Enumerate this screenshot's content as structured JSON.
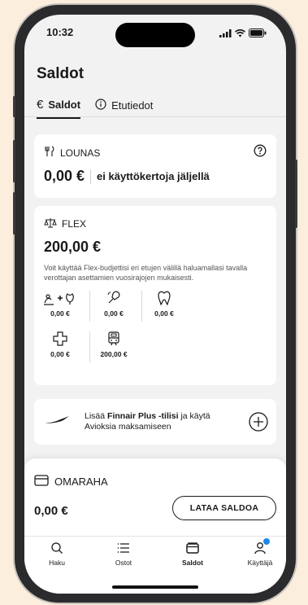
{
  "status_bar": {
    "time": "10:32"
  },
  "header": {
    "title": "Saldot"
  },
  "tabs": [
    {
      "label": "Saldot",
      "icon": "euro-icon",
      "active": true
    },
    {
      "label": "Etutiedot",
      "icon": "info-icon",
      "active": false
    }
  ],
  "lounas": {
    "title": "LOUNAS",
    "amount": "0,00 €",
    "note": "ei käyttökertoja jäljellä"
  },
  "flex": {
    "title": "FLEX",
    "amount": "200,00 €",
    "description": "Voit käyttää Flex-budjettisi eri etujen välillä haluamallasi tavalla verottajan asettamien vuosirajojen mukaisesti.",
    "benefits": [
      {
        "icon": "massage-plus-wellness-icon",
        "value": "0,00 €"
      },
      {
        "icon": "culture-icon",
        "value": "0,00 €"
      },
      {
        "icon": "tooth-icon",
        "value": "0,00 €"
      },
      {
        "icon": "health-cross-icon",
        "value": "0,00 €"
      },
      {
        "icon": "train-icon",
        "value": "200,00 €"
      }
    ]
  },
  "finnair": {
    "prefix": "Lisää ",
    "bold": "Finnair Plus -tilisi",
    "suffix": " ja käytä Avioksia maksamiseen"
  },
  "omaraha": {
    "title": "OMARAHA",
    "amount": "0,00 €",
    "button": "LATAA SALDOA"
  },
  "nav": [
    {
      "label": "Haku",
      "icon": "search-icon"
    },
    {
      "label": "Ostot",
      "icon": "list-icon"
    },
    {
      "label": "Saldot",
      "icon": "wallet-icon",
      "active": true
    },
    {
      "label": "Käyttäjä",
      "icon": "user-icon"
    }
  ],
  "colors": {
    "background": "#fbeedd",
    "screen": "#f2f2f2",
    "notification_dot": "#1e88e5"
  }
}
